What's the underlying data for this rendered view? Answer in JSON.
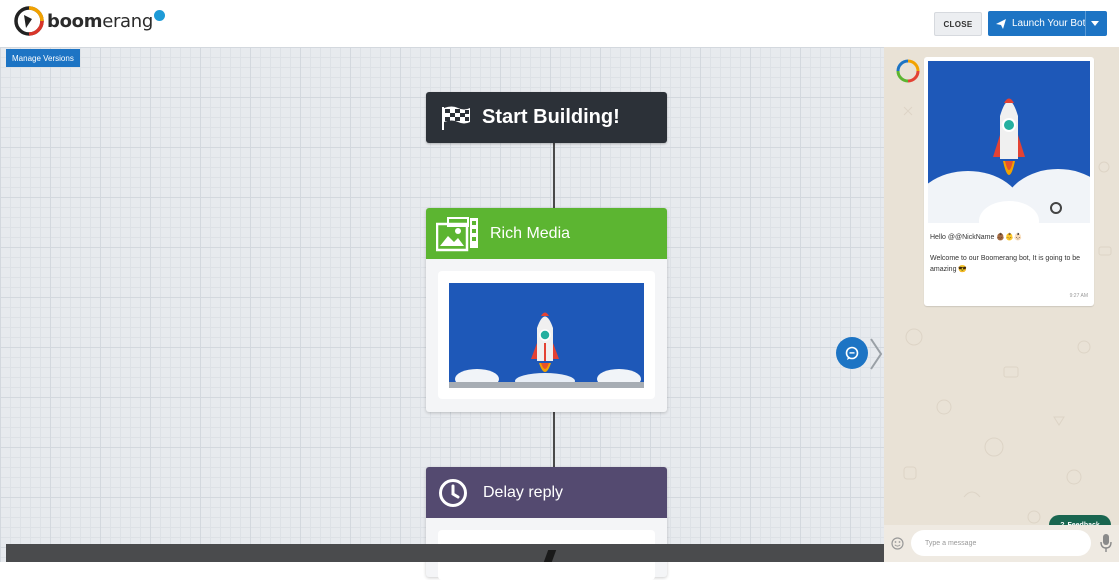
{
  "header": {
    "logo_text_bold": "boom",
    "logo_text_rest": "erang",
    "close_label": "CLOSE",
    "launch_label": "Launch Your Bot"
  },
  "canvas": {
    "manage_versions_label": "Manage Versions",
    "nodes": {
      "start": {
        "title": "Start Building!"
      },
      "rich_media": {
        "title": "Rich Media"
      },
      "delay": {
        "title": "Delay reply"
      }
    }
  },
  "chat": {
    "hello_text": "Hello @@NickName 👶🏾👶👶🏻",
    "welcome_text": "Welcome to our Boomerang bot, It is going to be amazing 😎",
    "time": "9:27 AM",
    "feedback_label": "Feedback",
    "input_placeholder": "Type a message"
  },
  "colors": {
    "brand_blue": "#1d74c4",
    "rich_media_green": "#5cb531",
    "delay_purple": "#544a70",
    "start_dark": "#2c3138",
    "feedback_green": "#1a6650"
  },
  "icons": {
    "start": "checkered-flag-icon",
    "rich_media": "media-gallery-icon",
    "delay": "clock-icon",
    "launch": "paper-plane-icon",
    "chat_toggle": "chat-bubble-icon"
  }
}
